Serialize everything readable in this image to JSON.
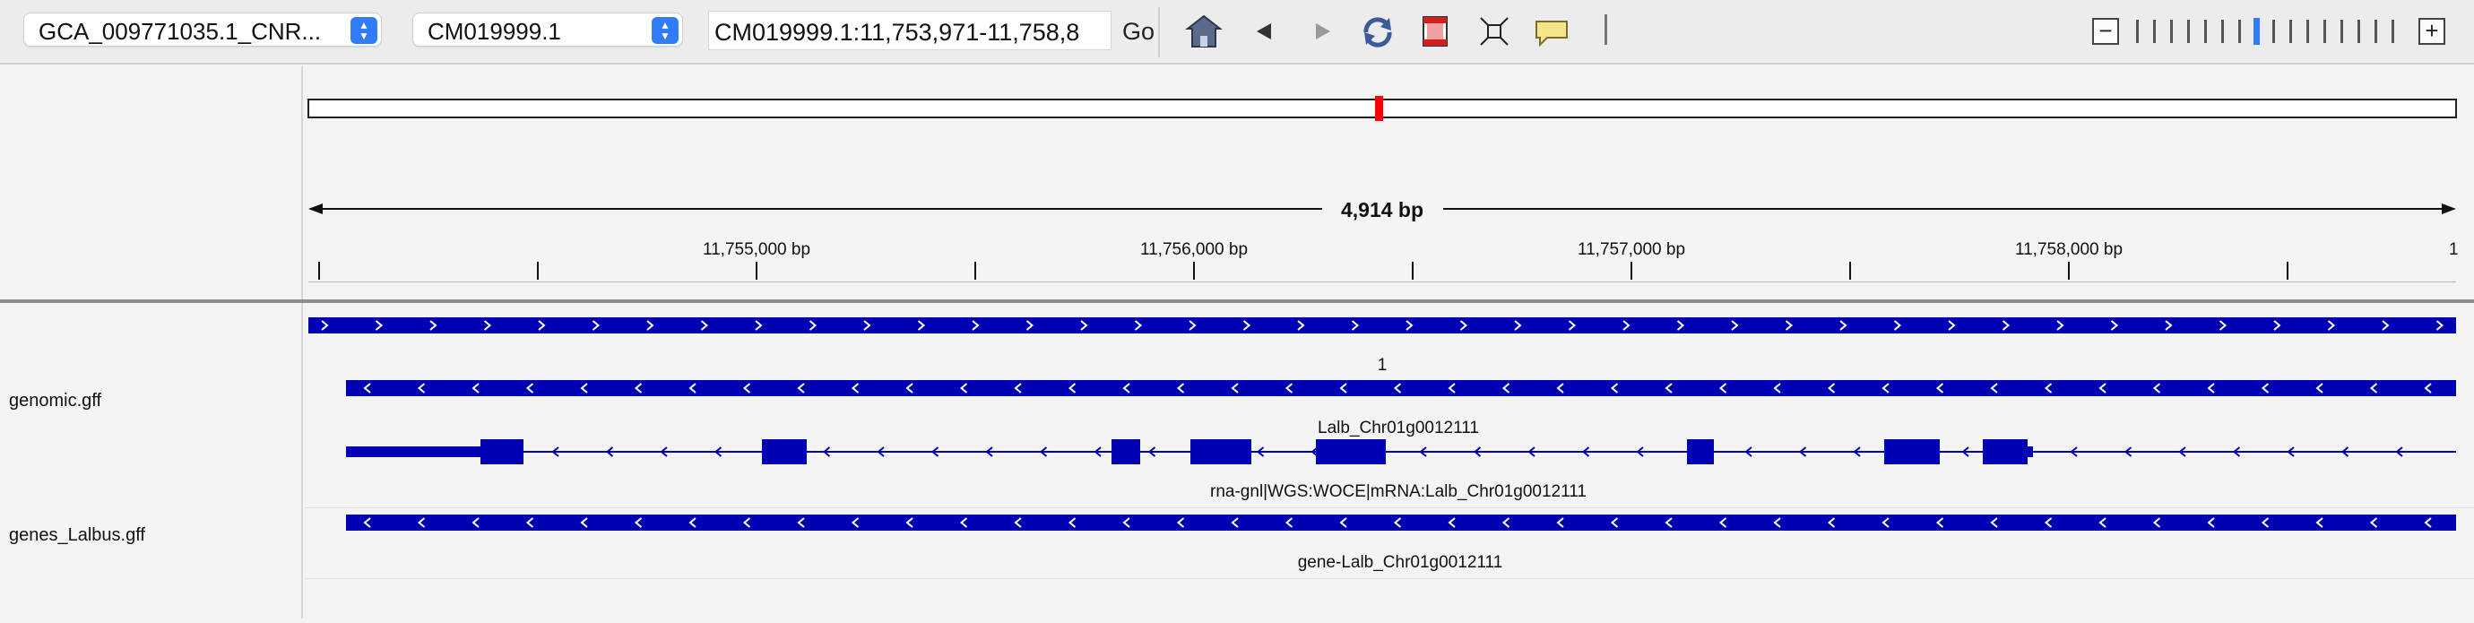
{
  "toolbar": {
    "genome_select": "GCA_009771035.1_CNR...",
    "chromosome_select": "CM019999.1",
    "locus_input": "CM019999.1:11,753,971-11,758,8",
    "go_label": "Go",
    "icons": [
      "home-icon",
      "back-arrow-icon",
      "forward-arrow-icon",
      "refresh-icon",
      "roi-icon",
      "fit-to-window-icon",
      "popup-text-icon"
    ],
    "zoom_out_label": "−",
    "zoom_in_label": "+",
    "zoom_level": 7,
    "zoom_levels_total": 16
  },
  "ruler": {
    "span_label": "4,914 bp",
    "tick_labels": [
      "11,755,000 bp",
      "11,756,000 bp",
      "11,757,000 bp",
      "11,758,000 bp"
    ],
    "edge_label": "1",
    "chromosome_marker_color": "#ff0000"
  },
  "tracks": {
    "genomic_gff": {
      "name": "genomic.gff",
      "features": [
        {
          "label": "1",
          "strand": "+"
        },
        {
          "label": "Lalb_Chr01g0012111",
          "strand": "-"
        },
        {
          "label": "rna-gnl|WGS:WOCE|mRNA:Lalb_Chr01g0012111",
          "strand": "-"
        }
      ]
    },
    "genes_lalbus": {
      "name": "genes_Lalbus.gff",
      "features": [
        {
          "label": "gene-Lalb_Chr01g0012111",
          "strand": "-"
        }
      ]
    }
  },
  "colors": {
    "feature": "#0000b3",
    "accent": "#2f7cf6"
  }
}
